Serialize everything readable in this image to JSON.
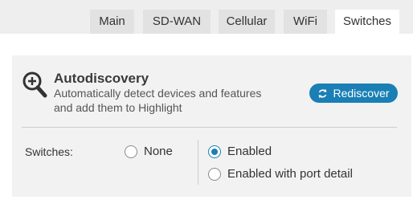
{
  "tabs": [
    {
      "label": "Main",
      "active": false
    },
    {
      "label": "SD-WAN",
      "active": false
    },
    {
      "label": "Cellular",
      "active": false
    },
    {
      "label": "WiFi",
      "active": false
    },
    {
      "label": "Switches",
      "active": true
    }
  ],
  "autodiscovery": {
    "title": "Autodiscovery",
    "description_line1": "Automatically detect devices and features",
    "description_line2": "and add them to Highlight",
    "rediscover_label": "Rediscover",
    "icon": "magnifier-plus-icon"
  },
  "switches": {
    "label": "Switches:",
    "options": [
      {
        "label": "None",
        "checked": false
      },
      {
        "label": "Enabled",
        "checked": true
      },
      {
        "label": "Enabled with port detail",
        "checked": false
      }
    ]
  },
  "colors": {
    "accent": "#1a7fb5",
    "tab_bar": "#eeeeee",
    "tab_inactive": "#e2e2e2",
    "panel": "#f2f2f2"
  }
}
